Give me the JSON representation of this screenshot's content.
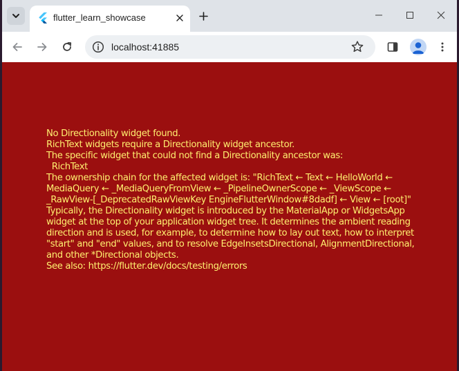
{
  "browser": {
    "tab": {
      "title": "flutter_learn_showcase",
      "favicon": "flutter-icon"
    },
    "address_bar": {
      "url": "localhost:41885"
    },
    "icons": {
      "tab_search": "chevron-down-icon",
      "tab_close": "close-icon",
      "new_tab": "plus-icon",
      "minimize": "minimize-icon",
      "maximize": "maximize-icon",
      "close": "close-icon",
      "back": "arrow-left-icon",
      "forward": "arrow-right-icon",
      "reload": "reload-icon",
      "site_info": "info-icon",
      "bookmark": "star-icon",
      "side_panel": "side-panel-icon",
      "profile": "profile-icon",
      "menu": "kebab-menu-icon"
    }
  },
  "page": {
    "background_color": "#9b0f0f",
    "text_color": "#ffef6f",
    "error_lines": [
      "No Directionality widget found.",
      "RichText widgets require a Directionality widget ancestor.",
      "The specific widget that could not find a Directionality ancestor was:",
      "  RichText",
      "The ownership chain for the affected widget is: \"RichText ← Text ← HelloWorld ←",
      "MediaQuery ← _MediaQueryFromView ← _PipelineOwnerScope ← _ViewScope ←",
      "_RawView-[_DeprecatedRawViewKey EngineFlutterWindow#8dadf] ← View ← [root]\"",
      "Typically, the Directionality widget is introduced by the MaterialApp or WidgetsApp",
      "widget at the top of your application widget tree. It determines the ambient reading",
      "direction and is used, for example, to determine how to lay out text, how to interpret",
      "\"start\" and \"end\" values, and to resolve EdgeInsetsDirectional, AlignmentDirectional,",
      "and other *Directional objects.",
      "See also: https://flutter.dev/docs/testing/errors"
    ]
  }
}
